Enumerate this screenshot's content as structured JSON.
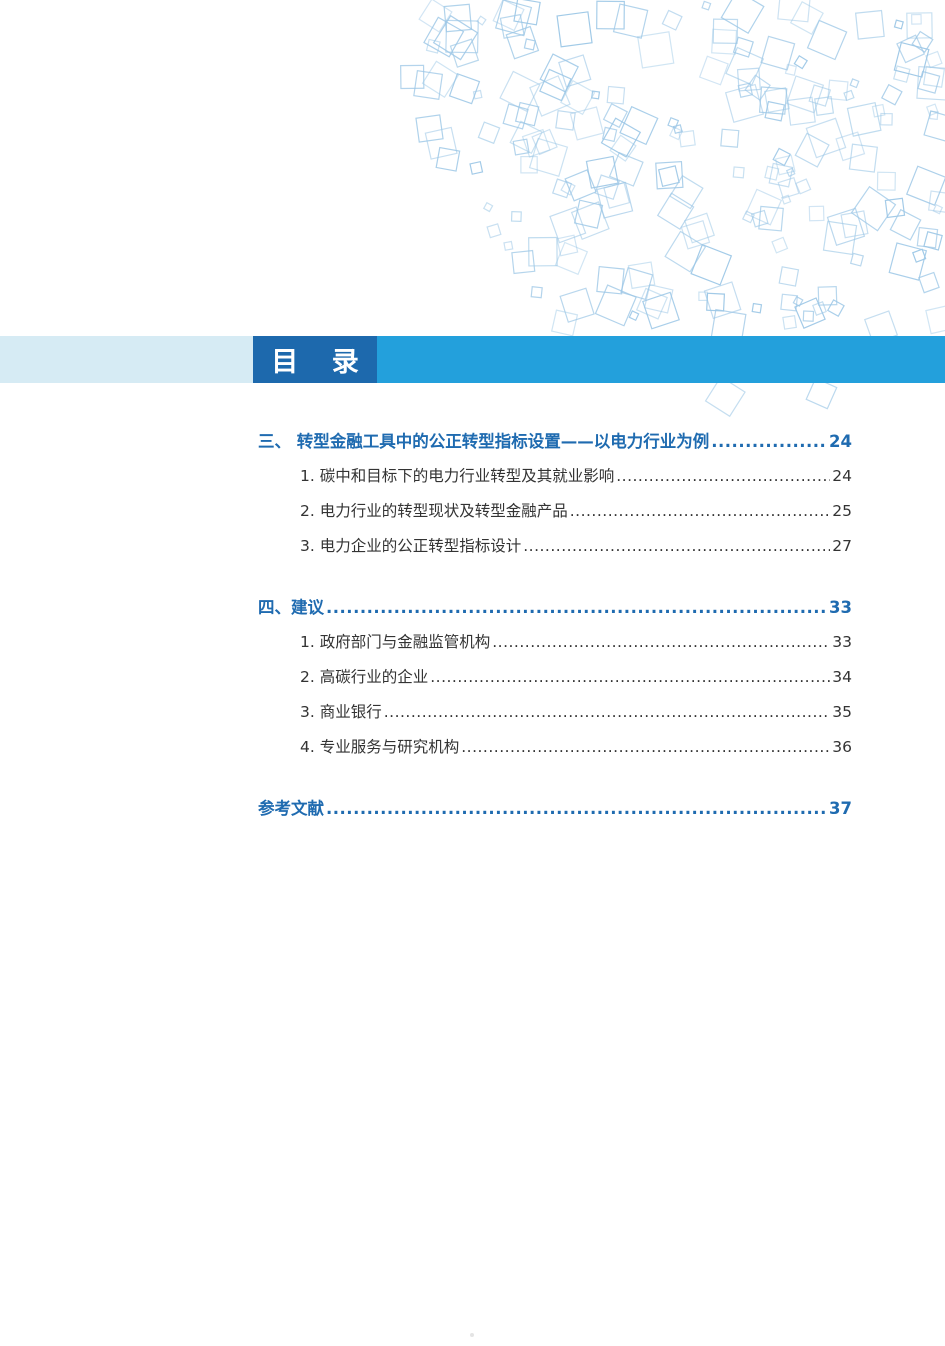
{
  "header": {
    "title": "目 录",
    "band_colors": {
      "left": "#d6ebf4",
      "title": "#1d69ad",
      "right": "#23a0dc"
    }
  },
  "toc": {
    "sections": [
      {
        "title": "三、 转型金融工具中的公正转型指标设置——以电力行业为例",
        "page": "24",
        "items": [
          {
            "title": "1. 碳中和目标下的电力行业转型及其就业影响",
            "page": "24"
          },
          {
            "title": "2. 电力行业的转型现状及转型金融产品",
            "page": "25"
          },
          {
            "title": "3. 电力企业的公正转型指标设计",
            "page": "27"
          }
        ]
      },
      {
        "title": "四、建议",
        "page": "33",
        "items": [
          {
            "title": "1. 政府部门与金融监管机构",
            "page": "33"
          },
          {
            "title": "2. 高碳行业的企业",
            "page": "34"
          },
          {
            "title": "3. 商业银行",
            "page": "35"
          },
          {
            "title": "4. 专业服务与研究机构",
            "page": "36"
          }
        ]
      },
      {
        "title": "参考文献",
        "page": "37",
        "items": []
      }
    ]
  },
  "colors": {
    "major": "#1f6bb0",
    "minor": "#333333",
    "decor_stroke": "#9cc7e6"
  }
}
